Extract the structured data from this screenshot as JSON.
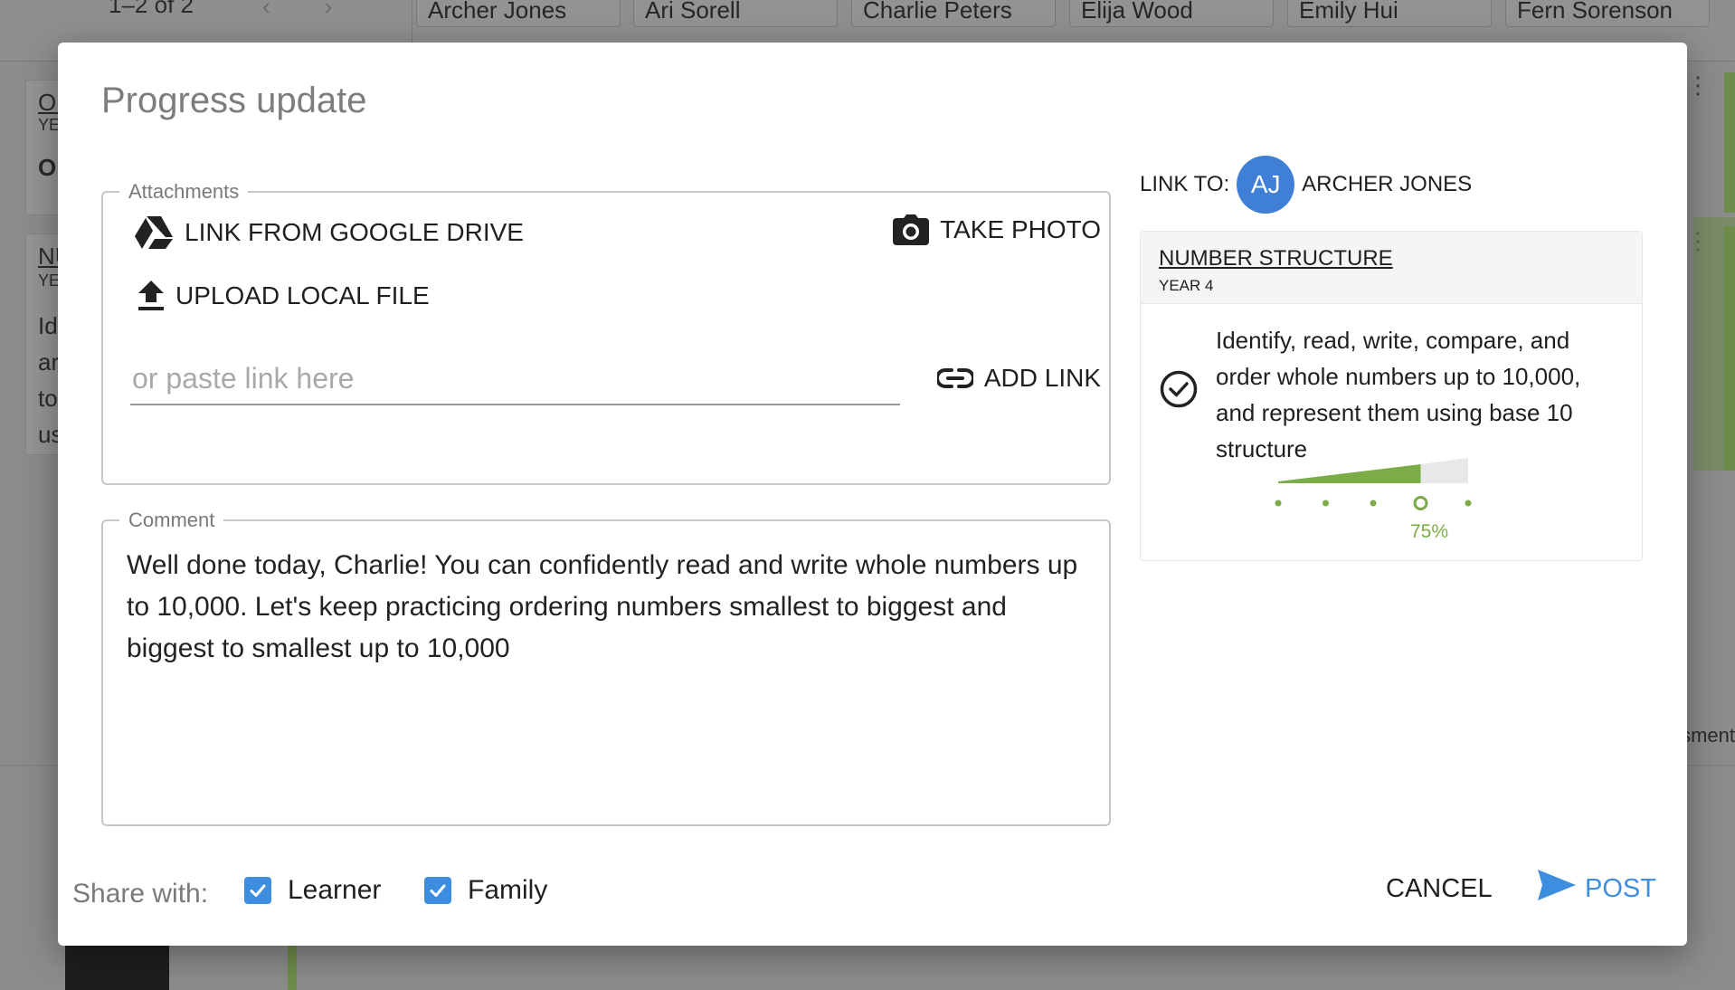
{
  "background": {
    "pager": "1–2 of 2",
    "student_tabs": [
      "Archer Jones",
      "Ari Sorell",
      "Charlie Peters",
      "Elija Wood",
      "Emily Hui",
      "Fern Sorenson"
    ],
    "card_fragments": [
      "OI",
      "YE",
      "O",
      "NU",
      "YE",
      "Id",
      "ar",
      "to",
      "us"
    ],
    "right_fragment": "sment"
  },
  "dialog": {
    "title": "Progress update",
    "attachments": {
      "legend": "Attachments",
      "google_drive_label": "LINK FROM GOOGLE DRIVE",
      "take_photo_label": "TAKE PHOTO",
      "upload_label": "UPLOAD LOCAL FILE",
      "link_placeholder": "or paste link here",
      "link_value": "",
      "add_link_label": "ADD LINK"
    },
    "comment": {
      "legend": "Comment",
      "text": "Well done today, Charlie! You can confidently read and write whole numbers up to 10,000. Let's keep practicing ordering numbers smallest to biggest and biggest to smallest up to 10,000"
    },
    "link_to": {
      "label": "LINK TO:",
      "avatar_initials": "AJ",
      "student_name": "ARCHER JONES",
      "avatar_color": "#3f7fd6"
    },
    "outcome": {
      "title": "NUMBER STRUCTURE",
      "year": "YEAR 4",
      "description": "Identify, read, write, compare, and order whole numbers up to 10,000, and represent them using base 10 structure",
      "progress_percent": 75,
      "progress_label": "75%",
      "progress_color": "#7cac47"
    },
    "footer": {
      "share_label": "Share with:",
      "share_options": [
        {
          "label": "Learner",
          "checked": true
        },
        {
          "label": "Family",
          "checked": true
        }
      ],
      "cancel_label": "CANCEL",
      "post_label": "POST",
      "accent_color": "#3e8ee0"
    }
  }
}
